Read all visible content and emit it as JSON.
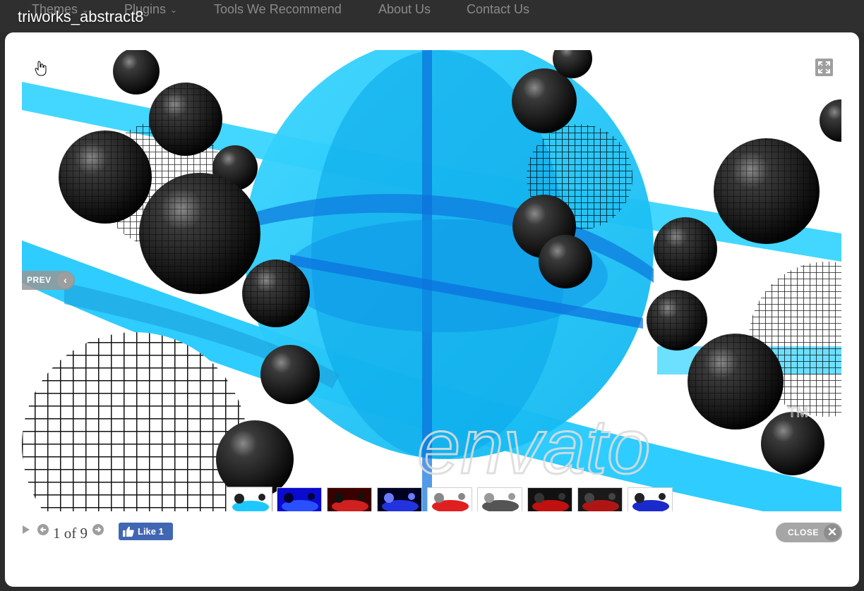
{
  "site_nav": {
    "items": [
      {
        "label": "Themes",
        "has_dropdown": true
      },
      {
        "label": "Plugins",
        "has_dropdown": true
      },
      {
        "label": "Tools We Recommend",
        "has_dropdown": false
      },
      {
        "label": "About Us",
        "has_dropdown": false
      },
      {
        "label": "Contact Us",
        "has_dropdown": false
      }
    ]
  },
  "lightbox": {
    "title": "triworks_abstract8",
    "prev_label": "PREV",
    "counter": "1 of 9",
    "close_label": "CLOSE",
    "fb_like_label": "Like 1",
    "watermark": "envato",
    "thumbnails": [
      {
        "icon": "thumbnail-spheres",
        "active": true,
        "colors": [
          "#ffffff",
          "#1ec8ff",
          "#222222"
        ]
      },
      {
        "icon": "thumbnail-blue",
        "active": false,
        "colors": [
          "#0b0bcf",
          "#2a4fff",
          "#000033"
        ]
      },
      {
        "icon": "thumbnail-red",
        "active": false,
        "colors": [
          "#3a0000",
          "#d02020",
          "#111111"
        ]
      },
      {
        "icon": "thumbnail-blue-ring",
        "active": false,
        "colors": [
          "#000022",
          "#2233dd",
          "#6a7bff"
        ]
      },
      {
        "icon": "thumbnail-red-ring",
        "active": false,
        "colors": [
          "#ffffff",
          "#e02020",
          "#888888"
        ]
      },
      {
        "icon": "thumbnail-grid",
        "active": false,
        "colors": [
          "#ffffff",
          "#555555",
          "#999999"
        ]
      },
      {
        "icon": "thumbnail-dark-red",
        "active": false,
        "colors": [
          "#111111",
          "#c01010",
          "#333333"
        ]
      },
      {
        "icon": "thumbnail-dark-red-2",
        "active": false,
        "colors": [
          "#1a1a1a",
          "#b01515",
          "#444444"
        ]
      },
      {
        "icon": "thumbnail-blue-disc",
        "active": false,
        "colors": [
          "#ffffff",
          "#1a2acc",
          "#222222"
        ]
      }
    ]
  },
  "colors": {
    "overlay": "#2b2b2b",
    "accent_cyan": "#1ec8ff",
    "fb_blue": "#4267b2",
    "button_gray": "#a6a6a6"
  }
}
